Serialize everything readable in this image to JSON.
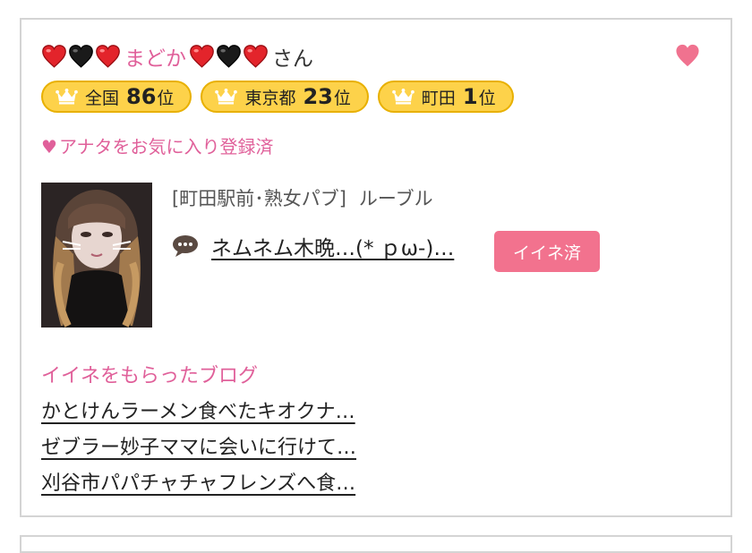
{
  "profile": {
    "name": "まどか",
    "suffix": "さん",
    "decoration_left": [
      "red-heart",
      "black-heart",
      "red-heart"
    ],
    "decoration_right": [
      "red-heart",
      "black-heart",
      "red-heart"
    ],
    "favorite_icon": "heart-icon",
    "favorited": true
  },
  "ranks": [
    {
      "area": "全国",
      "number": "86",
      "suffix": "位",
      "icon": "crown-icon"
    },
    {
      "area": "東京都",
      "number": "23",
      "suffix": "位",
      "icon": "crown-icon"
    },
    {
      "area": "町田",
      "number": "1",
      "suffix": "位",
      "icon": "crown-icon"
    }
  ],
  "favorite_status": {
    "icon": "♥",
    "text": "アナタをお気に入り登録済"
  },
  "shop": {
    "area_type": "[町田駅前･熟女パブ]",
    "name": "ルーブル"
  },
  "post": {
    "icon": "speech-bubble-icon",
    "text": "ネムネム木晩…(* ｐω-)…"
  },
  "like_button": {
    "label": "イイネ済"
  },
  "liked_blogs": {
    "title": "イイネをもらったブログ",
    "items": [
      "かとけんラーメン食べたキオクナ…",
      "ゼブラー妙子ママに会いに行けて…",
      "刈谷市パパチャチャフレンズへ食…"
    ]
  },
  "colors": {
    "accent_pink": "#e0609a",
    "button_pink": "#f2728e",
    "rank_gold": "#fdd24a",
    "rank_border": "#e8b000",
    "card_border": "#d4d4d4"
  }
}
